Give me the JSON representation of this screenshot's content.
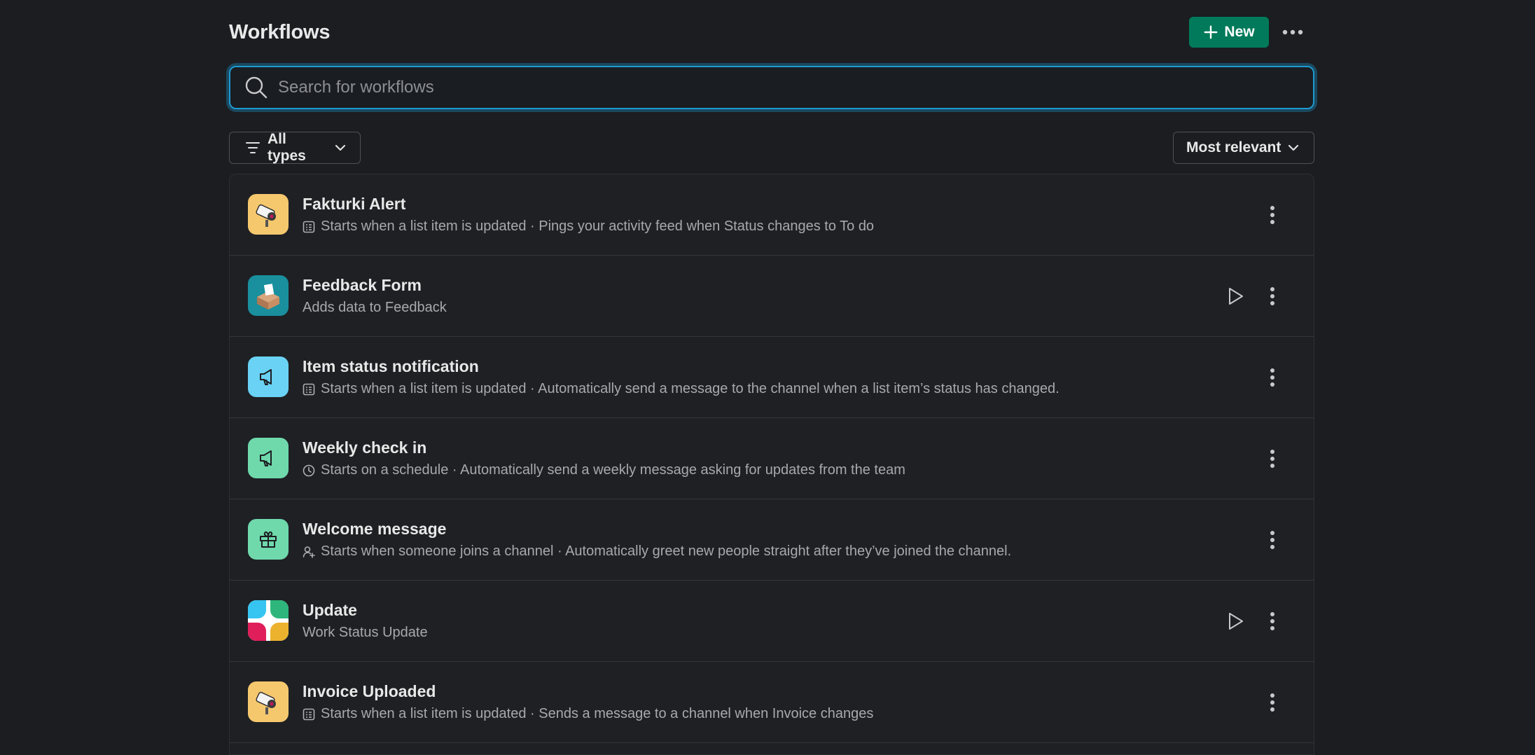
{
  "header": {
    "title": "Workflows",
    "new_label": "New"
  },
  "search": {
    "placeholder": "Search for workflows",
    "value": ""
  },
  "filter": {
    "label": "All types"
  },
  "sort": {
    "label": "Most relevant"
  },
  "colors": {
    "background": "#1b1d21",
    "accent_green": "#007a5a",
    "focus_blue": "#1d9bd1"
  },
  "workflows": [
    {
      "name": "Fakturki Alert",
      "trigger_icon": "list-icon",
      "description": "Starts when a list item is updated · Pings your activity feed when Status changes to To do",
      "app_icon": "camera-icon",
      "has_run": false
    },
    {
      "name": "Feedback Form",
      "trigger_icon": "",
      "description": "Adds data to Feedback",
      "app_icon": "ballot-box-icon",
      "has_run": true
    },
    {
      "name": "Item status notification",
      "trigger_icon": "list-icon",
      "description": "Starts when a list item is updated · Automatically send a message to the channel when a list item’s status has changed.",
      "app_icon": "megaphone-icon",
      "has_run": false
    },
    {
      "name": "Weekly check in",
      "trigger_icon": "clock-icon",
      "description": "Starts on a schedule · Automatically send a weekly message asking for updates from the team",
      "app_icon": "megaphone-icon",
      "has_run": false
    },
    {
      "name": "Welcome message",
      "trigger_icon": "user-add-icon",
      "description": "Starts when someone joins a channel · Automatically greet new people straight after they’ve joined the channel.",
      "app_icon": "gift-icon",
      "has_run": false
    },
    {
      "name": "Update",
      "trigger_icon": "",
      "description": "Work Status Update",
      "app_icon": "slack-logo-icon",
      "has_run": true
    },
    {
      "name": "Invoice Uploaded",
      "trigger_icon": "list-icon",
      "description": "Starts when a list item is updated · Sends a message to a channel when Invoice changes",
      "app_icon": "camera-icon",
      "has_run": false
    }
  ]
}
